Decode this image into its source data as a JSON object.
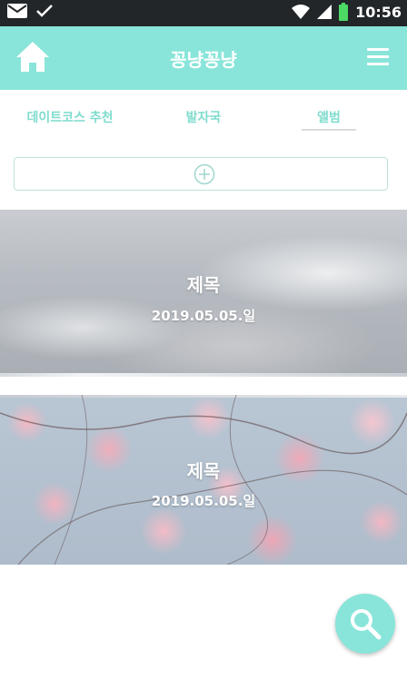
{
  "status_bar": {
    "time": "10:56"
  },
  "app_bar": {
    "title": "꽁냥꽁냥"
  },
  "tabs": [
    {
      "label": "데이트코스 추천",
      "active": false
    },
    {
      "label": "발자국",
      "active": false
    },
    {
      "label": "앨범",
      "active": true
    }
  ],
  "albums": [
    {
      "title": "제목",
      "date": "2019.05.05.일",
      "image": "cloudy-sky"
    },
    {
      "title": "제목",
      "date": "2019.05.05.일",
      "image": "cherry-blossom"
    }
  ],
  "icons": {
    "home": "home-icon",
    "menu": "hamburger-menu-icon",
    "add": "plus-circle-icon",
    "search": "search-icon"
  },
  "colors": {
    "accent": "#89e5d9",
    "tab_text": "#7fdccd",
    "status_bar": "#222629"
  }
}
